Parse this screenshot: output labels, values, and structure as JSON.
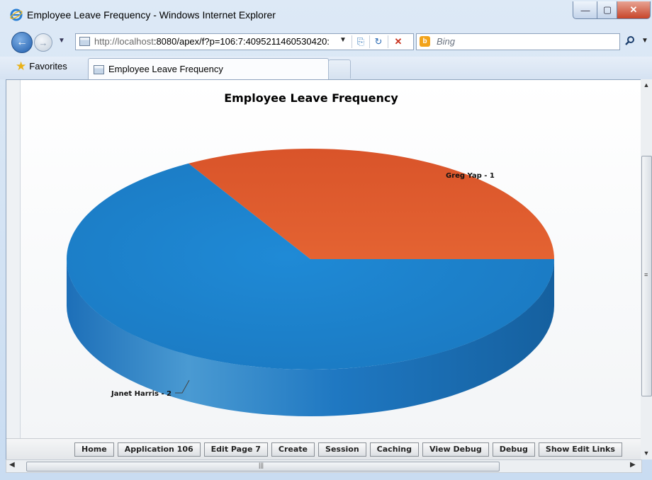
{
  "window": {
    "title": "Employee Leave Frequency - Windows Internet Explorer",
    "min_glyph": "—",
    "max_glyph": "▢",
    "close_glyph": "✕"
  },
  "nav": {
    "url_host": "http://localhost",
    "url_rest": ":8080/apex/f?p=106:7:4095211460530420:",
    "search_placeholder": "Bing",
    "bing_glyph": "b",
    "back_glyph": "←",
    "forward_glyph": "→"
  },
  "favorites": {
    "label": "Favorites",
    "tab_label": "Employee Leave Frequency"
  },
  "chart_data": {
    "type": "pie",
    "title": "Employee Leave Frequency",
    "slices": [
      {
        "label": "Janet Harris - 2",
        "name": "Janet Harris",
        "value": 2,
        "color": "#1e86cf"
      },
      {
        "label": "Greg Yap - 1",
        "name": "Greg Yap",
        "value": 1,
        "color": "#df5b2d"
      }
    ],
    "style": "3d"
  },
  "devbar": {
    "buttons": [
      "Home",
      "Application 106",
      "Edit Page 7",
      "Create",
      "Session",
      "Caching",
      "View Debug",
      "Debug",
      "Show Edit Links"
    ]
  },
  "colors": {
    "janet": "#1e86cf",
    "janet_side": "#1560a3",
    "greg": "#df5b2d"
  },
  "scroll": {
    "grip": "≡",
    "hgrip": "|||"
  }
}
